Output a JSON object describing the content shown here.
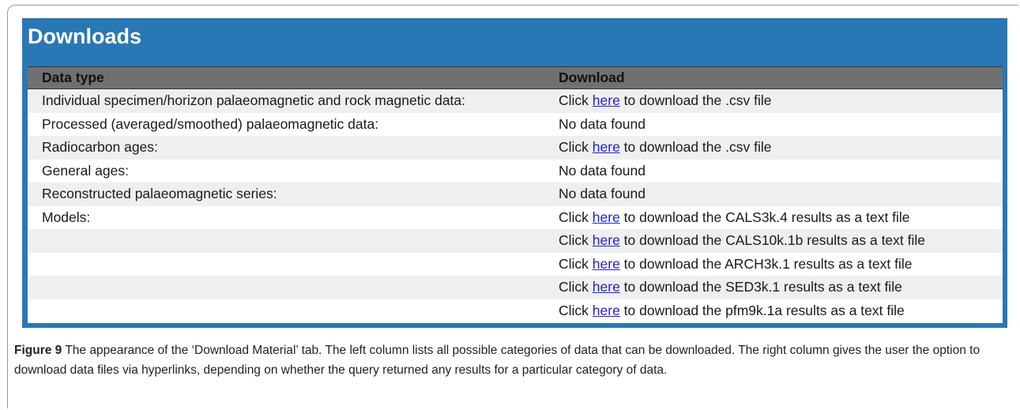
{
  "panel": {
    "title": "Downloads",
    "columns": [
      "Data type",
      "Download"
    ],
    "rows": [
      {
        "type": "Individual specimen/horizon palaeomagnetic and rock magnetic data:",
        "before": "Click ",
        "link": "here",
        "after": " to download the .csv file",
        "nodata": ""
      },
      {
        "type": "Processed (averaged/smoothed) palaeomagnetic data:",
        "before": "",
        "link": "",
        "after": "",
        "nodata": "No data found"
      },
      {
        "type": "Radiocarbon ages:",
        "before": "Click ",
        "link": "here",
        "after": " to download the .csv file",
        "nodata": ""
      },
      {
        "type": "General ages:",
        "before": "",
        "link": "",
        "after": "",
        "nodata": "No data found"
      },
      {
        "type": "Reconstructed palaeomagnetic series:",
        "before": "",
        "link": "",
        "after": "",
        "nodata": "No data found"
      },
      {
        "type": "Models:",
        "before": "Click ",
        "link": "here",
        "after": " to download the CALS3k.4 results as a text file",
        "nodata": ""
      },
      {
        "type": "",
        "before": "Click ",
        "link": "here",
        "after": " to download the CALS10k.1b results as a text file",
        "nodata": ""
      },
      {
        "type": "",
        "before": "Click ",
        "link": "here",
        "after": " to download the ARCH3k.1 results as a text file",
        "nodata": ""
      },
      {
        "type": "",
        "before": "Click ",
        "link": "here",
        "after": " to download the SED3k.1 results as a text file",
        "nodata": ""
      },
      {
        "type": "",
        "before": "Click ",
        "link": "here",
        "after": " to download the pfm9k.1a results as a text file",
        "nodata": ""
      }
    ]
  },
  "caption": {
    "label": "Figure 9",
    "text": "  The appearance of the ‘Download Material’ tab. The left column lists all possible categories of data that can be downloaded. The right column gives the user the option to download data files via hyperlinks, depending on whether the query returned any results for a particular category of data."
  },
  "colors": {
    "panel_blue": "#2a77b6",
    "header_grey": "#707070",
    "stripe_grey": "#efefef",
    "link_blue": "#2222cc"
  }
}
